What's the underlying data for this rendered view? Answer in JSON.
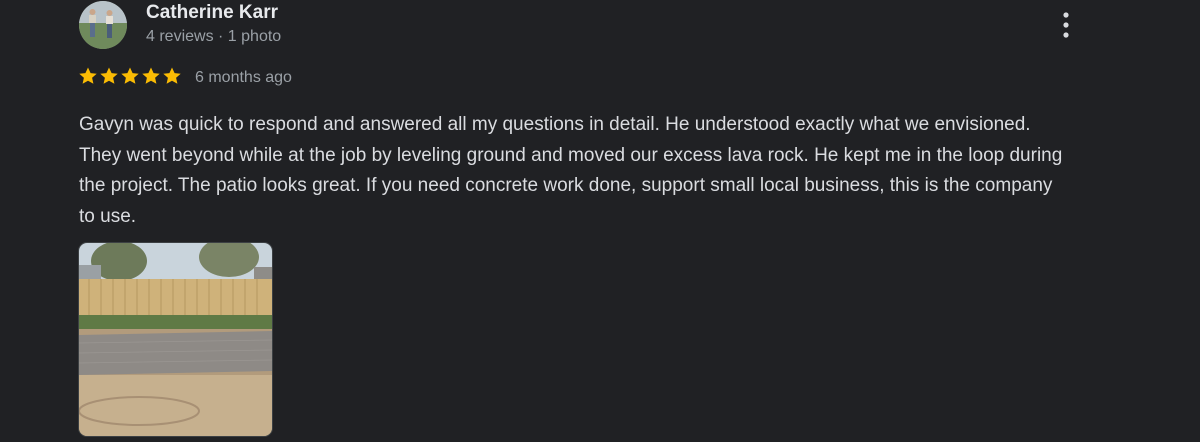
{
  "reviewer": {
    "name": "Catherine Karr",
    "meta": "4 reviews · 1 photo"
  },
  "rating": {
    "stars": 5,
    "max": 5,
    "time": "6 months ago"
  },
  "review": {
    "text": "Gavyn was quick to respond and answered all my questions in detail. He understood exactly what we envisioned. They went beyond while at the job by leveling ground and moved our excess lava rock. He kept me in the loop during the project. The patio looks great. If you need concrete work done, support small local business, this is the company to use."
  },
  "icons": {
    "menu": "more-vert-icon",
    "star": "star-icon"
  },
  "colors": {
    "background": "#202124",
    "star": "#fbbc04",
    "text": "#dadce0",
    "secondary": "#9aa0a6"
  }
}
